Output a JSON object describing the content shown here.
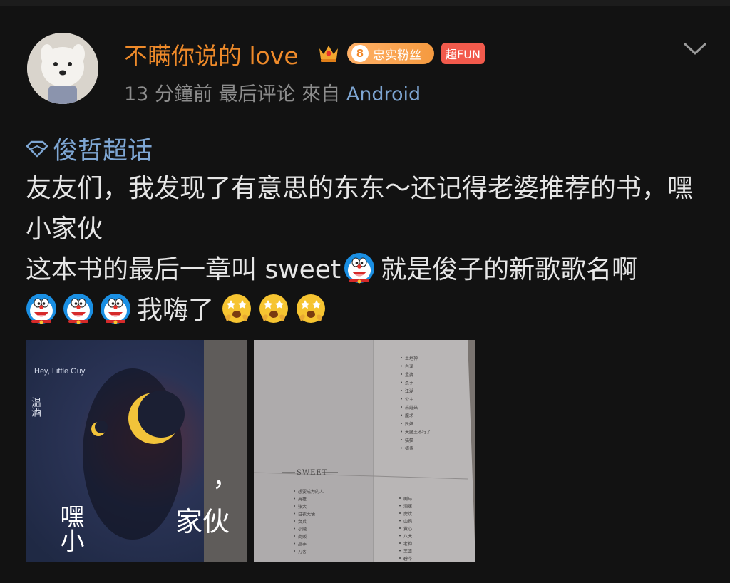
{
  "post": {
    "username": "不瞒你说的 love",
    "fan_badge": {
      "level": "8",
      "label": "忠实粉丝"
    },
    "fun_badge": "超FUN",
    "meta": {
      "time": "13 分鐘前",
      "status": "最后评论",
      "source_prefix": "來自",
      "source": "Android"
    },
    "topic": "俊哲超话",
    "lines": [
      "友友们，我发现了有意思的东东～还记得老婆推荐的书，嘿小家伙",
      "这本书的最后一章叫 sweet",
      "就是俊子的新歌歌名啊",
      "我嗨了"
    ]
  },
  "images": {
    "book_cover": {
      "english_title": "Hey, Little Guy",
      "author": "温酒",
      "title_right": "家伙",
      "title_left": "嘿小",
      "comma": "，"
    },
    "book_contents": {
      "section": "SWEET",
      "top_items": [
        "土地神",
        "白泽",
        "孟婆",
        "杀手",
        "江湖",
        "公主",
        "采蘑菇",
        "魔术",
        "民妖",
        "大魔王不行了",
        "猫猫",
        "搏傻"
      ],
      "bottom_left_items": [
        "想要成为的人",
        "英雄",
        "张大",
        "白衣天使",
        "女兵",
        "小贼",
        "商贩",
        "高手",
        "刀客"
      ],
      "bottom_right_items": [
        "剧马",
        "洞螺",
        "虎纹",
        "山鸦",
        "黄心",
        "八大",
        "老狗",
        "王盛",
        "碧岑"
      ]
    }
  },
  "icons": {
    "crown": "crown-icon",
    "topic": "diamond-icon",
    "doraemon": "doraemon-emoji",
    "star_eyes": "star-struck-emoji",
    "more": "chevron-down-icon"
  },
  "colors": {
    "background": "#121212",
    "username": "#ee8a2a",
    "link": "#7ea6d3",
    "meta": "#8d8d8d",
    "fun_badge": "#f25a4c"
  }
}
